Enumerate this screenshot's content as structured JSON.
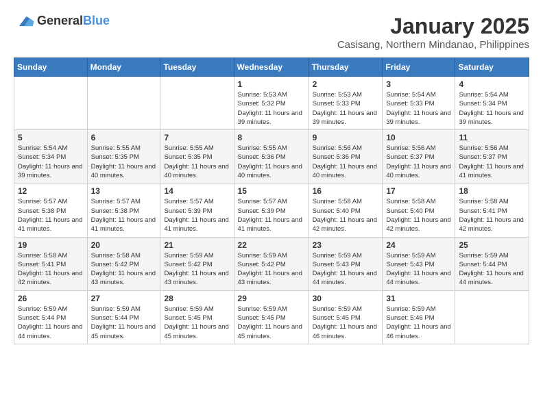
{
  "logo": {
    "general": "General",
    "blue": "Blue"
  },
  "header": {
    "title": "January 2025",
    "subtitle": "Casisang, Northern Mindanao, Philippines"
  },
  "weekdays": [
    "Sunday",
    "Monday",
    "Tuesday",
    "Wednesday",
    "Thursday",
    "Friday",
    "Saturday"
  ],
  "weeks": [
    [
      {
        "day": "",
        "sunrise": "",
        "sunset": "",
        "daylight": ""
      },
      {
        "day": "",
        "sunrise": "",
        "sunset": "",
        "daylight": ""
      },
      {
        "day": "",
        "sunrise": "",
        "sunset": "",
        "daylight": ""
      },
      {
        "day": "1",
        "sunrise": "Sunrise: 5:53 AM",
        "sunset": "Sunset: 5:32 PM",
        "daylight": "Daylight: 11 hours and 39 minutes."
      },
      {
        "day": "2",
        "sunrise": "Sunrise: 5:53 AM",
        "sunset": "Sunset: 5:33 PM",
        "daylight": "Daylight: 11 hours and 39 minutes."
      },
      {
        "day": "3",
        "sunrise": "Sunrise: 5:54 AM",
        "sunset": "Sunset: 5:33 PM",
        "daylight": "Daylight: 11 hours and 39 minutes."
      },
      {
        "day": "4",
        "sunrise": "Sunrise: 5:54 AM",
        "sunset": "Sunset: 5:34 PM",
        "daylight": "Daylight: 11 hours and 39 minutes."
      }
    ],
    [
      {
        "day": "5",
        "sunrise": "Sunrise: 5:54 AM",
        "sunset": "Sunset: 5:34 PM",
        "daylight": "Daylight: 11 hours and 39 minutes."
      },
      {
        "day": "6",
        "sunrise": "Sunrise: 5:55 AM",
        "sunset": "Sunset: 5:35 PM",
        "daylight": "Daylight: 11 hours and 40 minutes."
      },
      {
        "day": "7",
        "sunrise": "Sunrise: 5:55 AM",
        "sunset": "Sunset: 5:35 PM",
        "daylight": "Daylight: 11 hours and 40 minutes."
      },
      {
        "day": "8",
        "sunrise": "Sunrise: 5:55 AM",
        "sunset": "Sunset: 5:36 PM",
        "daylight": "Daylight: 11 hours and 40 minutes."
      },
      {
        "day": "9",
        "sunrise": "Sunrise: 5:56 AM",
        "sunset": "Sunset: 5:36 PM",
        "daylight": "Daylight: 11 hours and 40 minutes."
      },
      {
        "day": "10",
        "sunrise": "Sunrise: 5:56 AM",
        "sunset": "Sunset: 5:37 PM",
        "daylight": "Daylight: 11 hours and 40 minutes."
      },
      {
        "day": "11",
        "sunrise": "Sunrise: 5:56 AM",
        "sunset": "Sunset: 5:37 PM",
        "daylight": "Daylight: 11 hours and 41 minutes."
      }
    ],
    [
      {
        "day": "12",
        "sunrise": "Sunrise: 5:57 AM",
        "sunset": "Sunset: 5:38 PM",
        "daylight": "Daylight: 11 hours and 41 minutes."
      },
      {
        "day": "13",
        "sunrise": "Sunrise: 5:57 AM",
        "sunset": "Sunset: 5:38 PM",
        "daylight": "Daylight: 11 hours and 41 minutes."
      },
      {
        "day": "14",
        "sunrise": "Sunrise: 5:57 AM",
        "sunset": "Sunset: 5:39 PM",
        "daylight": "Daylight: 11 hours and 41 minutes."
      },
      {
        "day": "15",
        "sunrise": "Sunrise: 5:57 AM",
        "sunset": "Sunset: 5:39 PM",
        "daylight": "Daylight: 11 hours and 41 minutes."
      },
      {
        "day": "16",
        "sunrise": "Sunrise: 5:58 AM",
        "sunset": "Sunset: 5:40 PM",
        "daylight": "Daylight: 11 hours and 42 minutes."
      },
      {
        "day": "17",
        "sunrise": "Sunrise: 5:58 AM",
        "sunset": "Sunset: 5:40 PM",
        "daylight": "Daylight: 11 hours and 42 minutes."
      },
      {
        "day": "18",
        "sunrise": "Sunrise: 5:58 AM",
        "sunset": "Sunset: 5:41 PM",
        "daylight": "Daylight: 11 hours and 42 minutes."
      }
    ],
    [
      {
        "day": "19",
        "sunrise": "Sunrise: 5:58 AM",
        "sunset": "Sunset: 5:41 PM",
        "daylight": "Daylight: 11 hours and 42 minutes."
      },
      {
        "day": "20",
        "sunrise": "Sunrise: 5:58 AM",
        "sunset": "Sunset: 5:42 PM",
        "daylight": "Daylight: 11 hours and 43 minutes."
      },
      {
        "day": "21",
        "sunrise": "Sunrise: 5:59 AM",
        "sunset": "Sunset: 5:42 PM",
        "daylight": "Daylight: 11 hours and 43 minutes."
      },
      {
        "day": "22",
        "sunrise": "Sunrise: 5:59 AM",
        "sunset": "Sunset: 5:42 PM",
        "daylight": "Daylight: 11 hours and 43 minutes."
      },
      {
        "day": "23",
        "sunrise": "Sunrise: 5:59 AM",
        "sunset": "Sunset: 5:43 PM",
        "daylight": "Daylight: 11 hours and 44 minutes."
      },
      {
        "day": "24",
        "sunrise": "Sunrise: 5:59 AM",
        "sunset": "Sunset: 5:43 PM",
        "daylight": "Daylight: 11 hours and 44 minutes."
      },
      {
        "day": "25",
        "sunrise": "Sunrise: 5:59 AM",
        "sunset": "Sunset: 5:44 PM",
        "daylight": "Daylight: 11 hours and 44 minutes."
      }
    ],
    [
      {
        "day": "26",
        "sunrise": "Sunrise: 5:59 AM",
        "sunset": "Sunset: 5:44 PM",
        "daylight": "Daylight: 11 hours and 44 minutes."
      },
      {
        "day": "27",
        "sunrise": "Sunrise: 5:59 AM",
        "sunset": "Sunset: 5:44 PM",
        "daylight": "Daylight: 11 hours and 45 minutes."
      },
      {
        "day": "28",
        "sunrise": "Sunrise: 5:59 AM",
        "sunset": "Sunset: 5:45 PM",
        "daylight": "Daylight: 11 hours and 45 minutes."
      },
      {
        "day": "29",
        "sunrise": "Sunrise: 5:59 AM",
        "sunset": "Sunset: 5:45 PM",
        "daylight": "Daylight: 11 hours and 45 minutes."
      },
      {
        "day": "30",
        "sunrise": "Sunrise: 5:59 AM",
        "sunset": "Sunset: 5:45 PM",
        "daylight": "Daylight: 11 hours and 46 minutes."
      },
      {
        "day": "31",
        "sunrise": "Sunrise: 5:59 AM",
        "sunset": "Sunset: 5:46 PM",
        "daylight": "Daylight: 11 hours and 46 minutes."
      },
      {
        "day": "",
        "sunrise": "",
        "sunset": "",
        "daylight": ""
      }
    ]
  ]
}
